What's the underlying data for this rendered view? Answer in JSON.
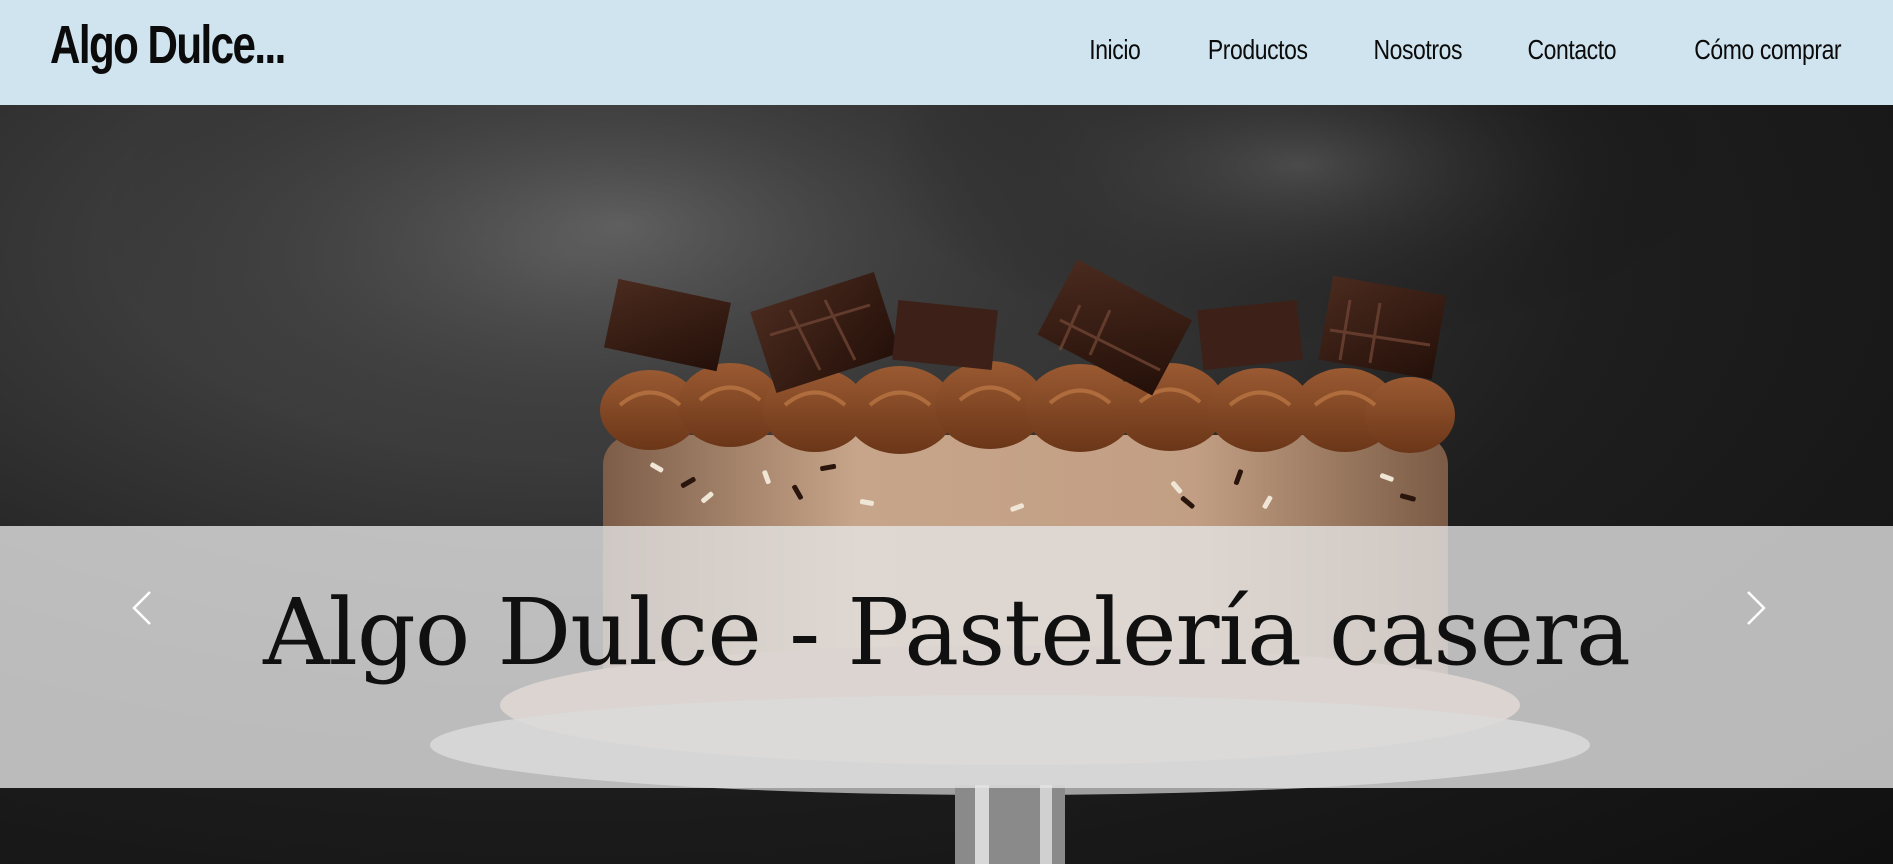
{
  "brand": {
    "name": "Algo Dulce..."
  },
  "nav": {
    "items": [
      {
        "label": "Inicio"
      },
      {
        "label": "Productos"
      },
      {
        "label": "Nosotros"
      },
      {
        "label": "Contacto"
      },
      {
        "label": "Cómo comprar"
      }
    ]
  },
  "hero": {
    "caption": "Algo Dulce - Pastelería casera",
    "prev_icon": "chevron-left-icon",
    "next_icon": "chevron-right-icon"
  },
  "colors": {
    "header_bg": "#cfe4ee",
    "text": "#0b0b0b",
    "caption_band": "#e4e4e4"
  }
}
